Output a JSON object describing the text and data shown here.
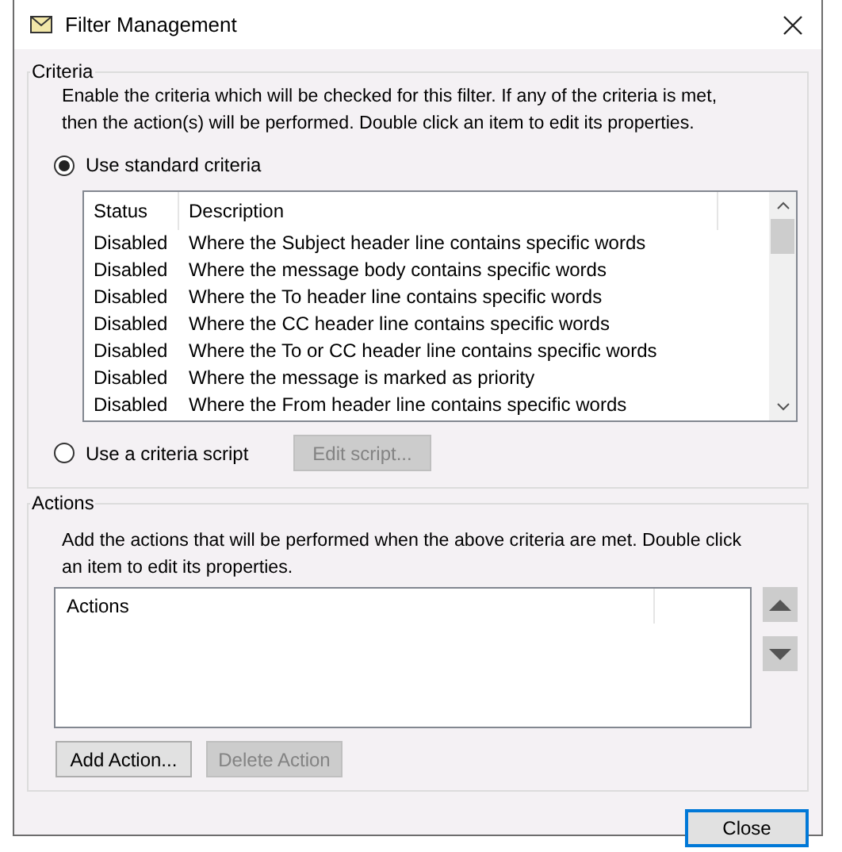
{
  "window": {
    "title": "Filter Management"
  },
  "criteria": {
    "title": "Criteria",
    "description": "Enable the criteria which will be checked for this filter. If any of the criteria is met, then the action(s) will be performed. Double click an item to edit its properties.",
    "options": [
      {
        "label": "Use standard criteria",
        "selected": true
      },
      {
        "label": "Use a criteria script",
        "selected": false
      }
    ],
    "columns": [
      "Status",
      "Description"
    ],
    "rows": [
      {
        "status": "Disabled",
        "description": "Where the Subject header line contains specific words"
      },
      {
        "status": "Disabled",
        "description": "Where the message body contains specific words"
      },
      {
        "status": "Disabled",
        "description": "Where the To header line contains specific words"
      },
      {
        "status": "Disabled",
        "description": "Where the CC header line contains specific words"
      },
      {
        "status": "Disabled",
        "description": "Where the To or CC header line contains specific words"
      },
      {
        "status": "Disabled",
        "description": "Where the message is marked as priority"
      },
      {
        "status": "Disabled",
        "description": "Where the From header line contains specific words"
      }
    ],
    "edit_button": {
      "label": "Edit script...",
      "disabled": true
    }
  },
  "actions": {
    "title": "Actions",
    "description": "Add the actions that will be performed when the above criteria are met. Double click an item to edit its properties.",
    "columns": [
      "Actions"
    ],
    "buttons": [
      {
        "label": "Add Action...",
        "disabled": false
      },
      {
        "label": "Delete Action",
        "disabled": true
      }
    ]
  },
  "close_button": {
    "label": "Close"
  }
}
